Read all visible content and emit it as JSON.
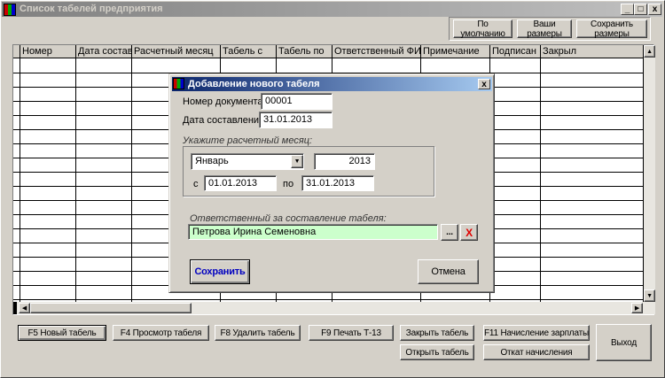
{
  "window": {
    "title": "Список табелей предприятия"
  },
  "toolbar": {
    "default": "По умолчанию",
    "your_sizes": "Ваши размеры",
    "save_sizes": "Сохранить размеры"
  },
  "grid": {
    "columns": [
      "Номер",
      "Дата состав.",
      "Расчетный месяц",
      "Табель с",
      "Табель по",
      "Ответственный ФИО",
      "Примечание",
      "Подписан",
      "Закрыл"
    ]
  },
  "dialog": {
    "title": "Добавление нового табеля",
    "doc_number_label": "Номер документа:",
    "doc_number": "00001",
    "date_label": "Дата составления:",
    "date": "31.01.2013",
    "month_group_label": "Укажите расчетный месяц:",
    "month": "Январь",
    "year": "2013",
    "from_label": "с",
    "from": "01.01.2013",
    "to_label": "по",
    "to": "31.01.2013",
    "responsible_label": "Ответственный за составление табеля:",
    "responsible": "Петрова Ирина Семеновна",
    "browse": "...",
    "clear": "X",
    "save": "Сохранить",
    "cancel": "Отмена"
  },
  "buttons": {
    "new": "F5 Новый табель",
    "view": "F4 Просмотр табеля",
    "delete": "F8 Удалить табель",
    "print": "F9 Печать Т-13",
    "close": "Закрыть табель",
    "open": "Открыть табель",
    "payroll": "F11 Начисление зарплаты",
    "rollback": "Откат начисления",
    "exit": "Выход"
  }
}
